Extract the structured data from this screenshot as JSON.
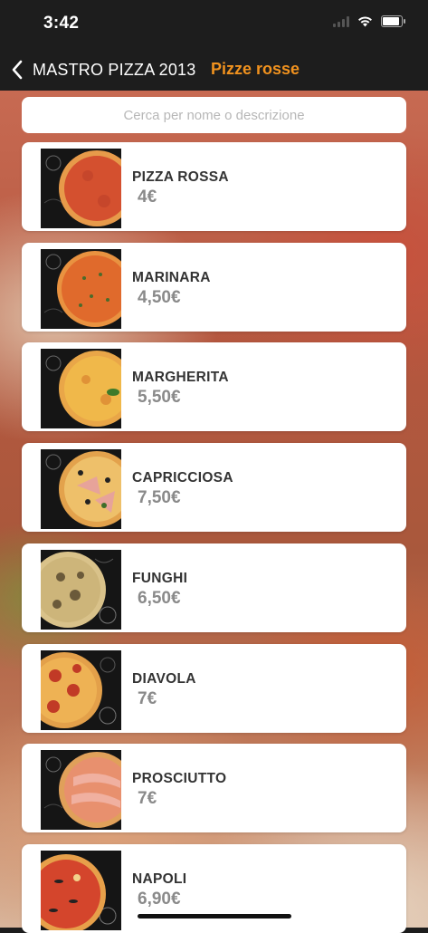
{
  "status_bar": {
    "time": "3:42"
  },
  "nav": {
    "back_label": "MASTRO PIZZA 2013",
    "subtitle": "Pizze rosse",
    "subtitle_color": "#f1921e"
  },
  "search": {
    "placeholder": "Cerca per nome o descrizione",
    "value": ""
  },
  "pizzas": [
    {
      "name": "PIZZA ROSSA",
      "price": "4€",
      "image_icon": "pizza-rossa-image"
    },
    {
      "name": "MARINARA",
      "price": "4,50€",
      "image_icon": "marinara-image"
    },
    {
      "name": "MARGHERITA",
      "price": "5,50€",
      "image_icon": "margherita-image"
    },
    {
      "name": "CAPRICCIOSA",
      "price": "7,50€",
      "image_icon": "capricciosa-image"
    },
    {
      "name": "FUNGHI",
      "price": "6,50€",
      "image_icon": "funghi-image"
    },
    {
      "name": "DIAVOLA",
      "price": "7€",
      "image_icon": "diavola-image"
    },
    {
      "name": "PROSCIUTTO",
      "price": "7€",
      "image_icon": "prosciutto-image"
    },
    {
      "name": "NAPOLI",
      "price": "6,90€",
      "image_icon": "napoli-image"
    }
  ],
  "colors": {
    "nav_background": "#1d1d1d",
    "card_background": "#ffffff",
    "price_text": "#8a8a8a",
    "name_text": "#333333"
  }
}
